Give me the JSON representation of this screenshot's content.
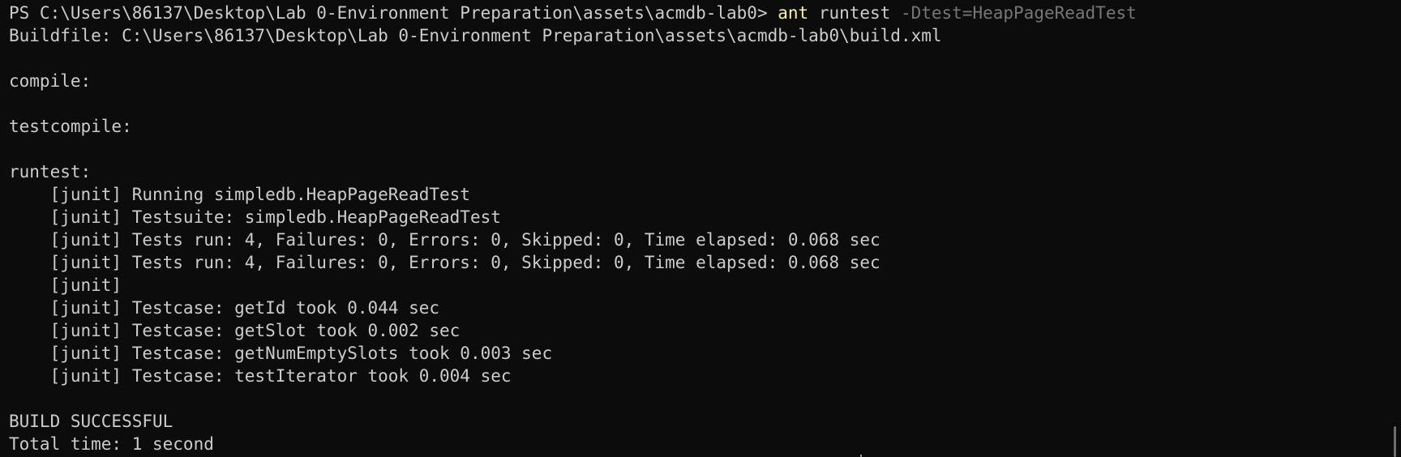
{
  "terminal": {
    "prompt": "PS C:\\Users\\86137\\Desktop\\Lab 0-Environment Preparation\\assets\\acmdb-lab0> ",
    "command": {
      "name": "ant",
      "arg": " runtest ",
      "param": "-Dtest=HeapPageReadTest"
    },
    "lines": [
      "Buildfile: C:\\Users\\86137\\Desktop\\Lab 0-Environment Preparation\\assets\\acmdb-lab0\\build.xml",
      "",
      "compile:",
      "",
      "testcompile:",
      "",
      "runtest:",
      "    [junit] Running simpledb.HeapPageReadTest",
      "    [junit] Testsuite: simpledb.HeapPageReadTest",
      "    [junit] Tests run: 4, Failures: 0, Errors: 0, Skipped: 0, Time elapsed: 0.068 sec",
      "    [junit] Tests run: 4, Failures: 0, Errors: 0, Skipped: 0, Time elapsed: 0.068 sec",
      "    [junit]",
      "    [junit] Testcase: getId took 0.044 sec",
      "    [junit] Testcase: getSlot took 0.002 sec",
      "    [junit] Testcase: getNumEmptySlots took 0.003 sec",
      "    [junit] Testcase: testIterator took 0.004 sec",
      "",
      "BUILD SUCCESSFUL",
      "Total time: 1 second"
    ]
  },
  "colors": {
    "background": "#0c0c0c",
    "foreground": "#cccccc",
    "command": "#f9f1a5",
    "parameter": "#767676"
  }
}
